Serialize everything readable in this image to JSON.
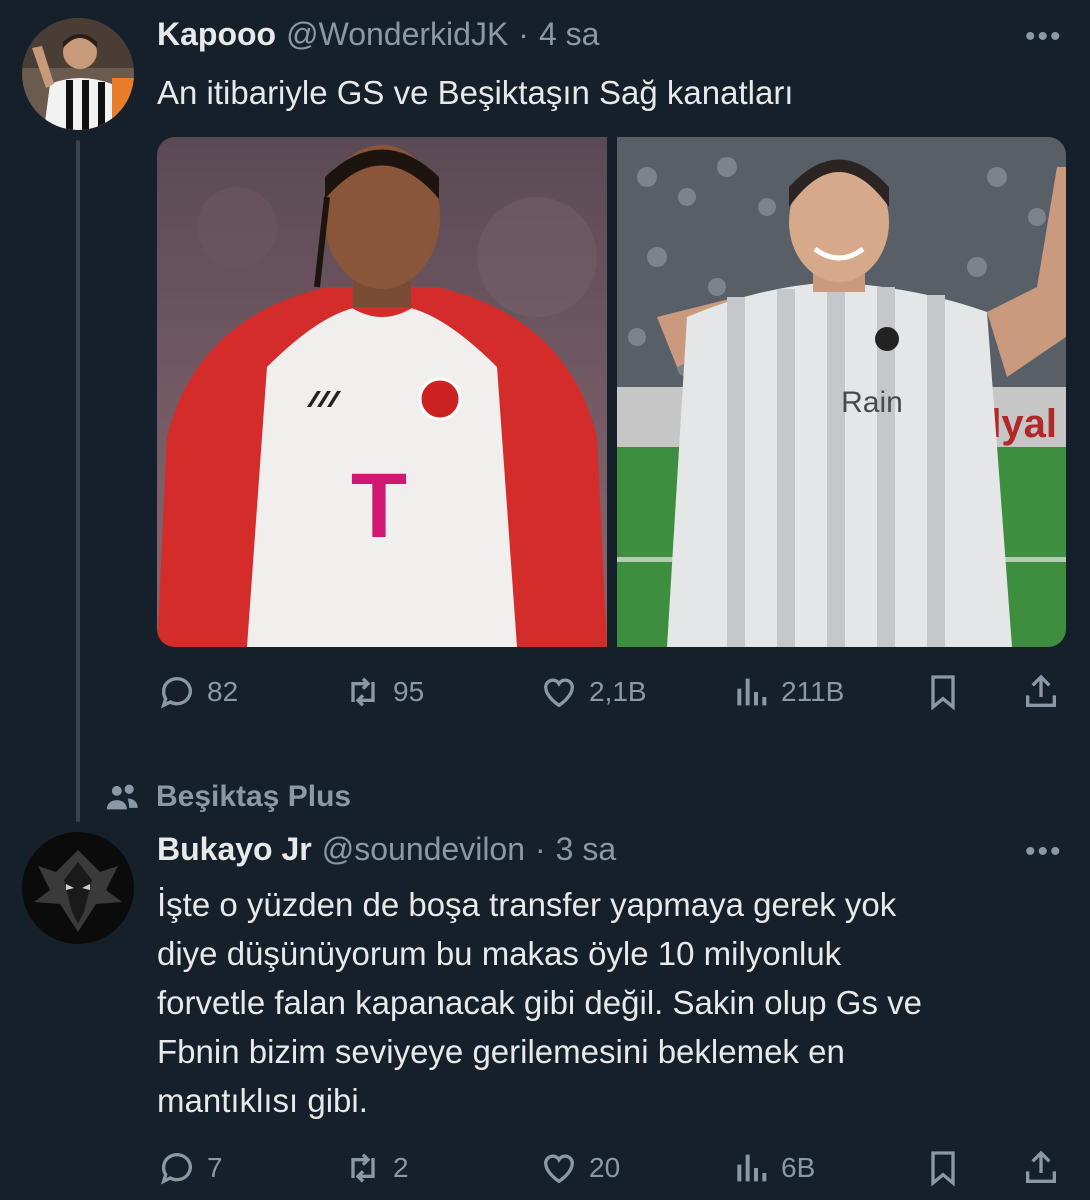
{
  "tweet1": {
    "display_name": "Kapooo",
    "handle": "@WonderkidJK",
    "separator": "·",
    "time": "4 sa",
    "text": "An itibariyle GS ve Beşiktaşın Sağ kanatları",
    "media_left_label": "T",
    "media_right_label": "Rain",
    "media_right_board": "ndyal",
    "stats": {
      "replies": "82",
      "retweets": "95",
      "likes": "2,1B",
      "views": "211B"
    }
  },
  "community": {
    "label": "Beşiktaş Plus"
  },
  "tweet2": {
    "display_name": "Bukayo Jr",
    "handle": "@soundevilon",
    "separator": "·",
    "time": "3 sa",
    "lines": [
      "İşte o yüzden de boşa transfer yapmaya gerek yok",
      "diye düşünüyorum bu makas öyle 10 milyonluk",
      "forvetle falan kapanacak gibi değil. Sakin olup Gs ve",
      "Fbnin bizim seviyeye gerilemesini beklemek en",
      "mantıklısı gibi."
    ],
    "stats": {
      "replies": "7",
      "retweets": "2",
      "likes": "20",
      "views": "6B"
    }
  },
  "colors": {
    "background": "#15202b",
    "text": "#e7e9ea",
    "muted": "#8b98a5",
    "thread_line": "#38444d"
  },
  "icons": [
    "more-icon",
    "reply-icon",
    "retweet-icon",
    "like-icon",
    "views-icon",
    "bookmark-icon",
    "share-icon",
    "community-icon"
  ]
}
